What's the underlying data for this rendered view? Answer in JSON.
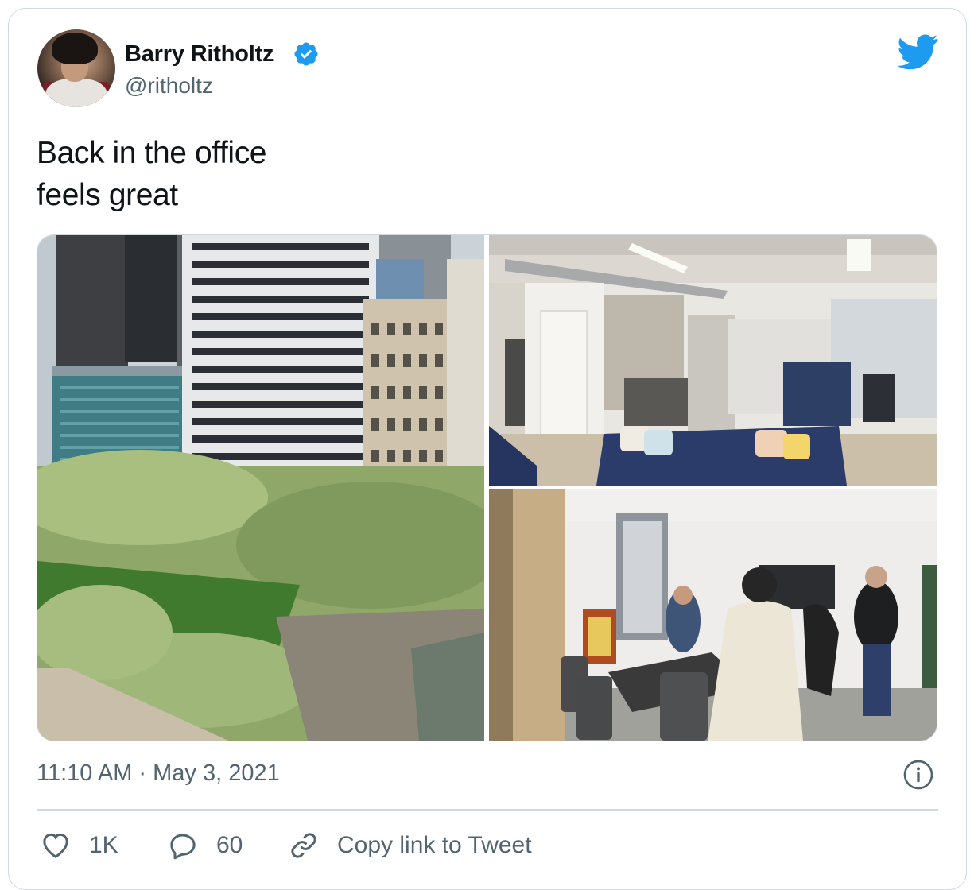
{
  "author": {
    "name": "Barry Ritholtz",
    "handle": "@ritholtz",
    "verified": true,
    "avatar_icon": "profile-photo"
  },
  "tweet": {
    "lines": [
      "Back in the office",
      "feels great"
    ],
    "timestamp": "11:10 AM · May 3, 2021"
  },
  "media": [
    {
      "name": "city-park-photo",
      "icon": "photo"
    },
    {
      "name": "office-lounge-photo",
      "icon": "photo"
    },
    {
      "name": "conference-room-photo",
      "icon": "photo"
    }
  ],
  "actions": {
    "like_count": "1K",
    "reply_count": "60",
    "copy_link_label": "Copy link to Tweet"
  },
  "colors": {
    "twitter_blue": "#1d9bf0",
    "secondary_text": "#536471",
    "border": "#cfd9de",
    "primary_text": "#0f1419"
  },
  "icons": [
    "verified-badge-icon",
    "twitter-bird-icon",
    "info-icon",
    "heart-icon",
    "reply-bubble-icon",
    "link-icon"
  ]
}
